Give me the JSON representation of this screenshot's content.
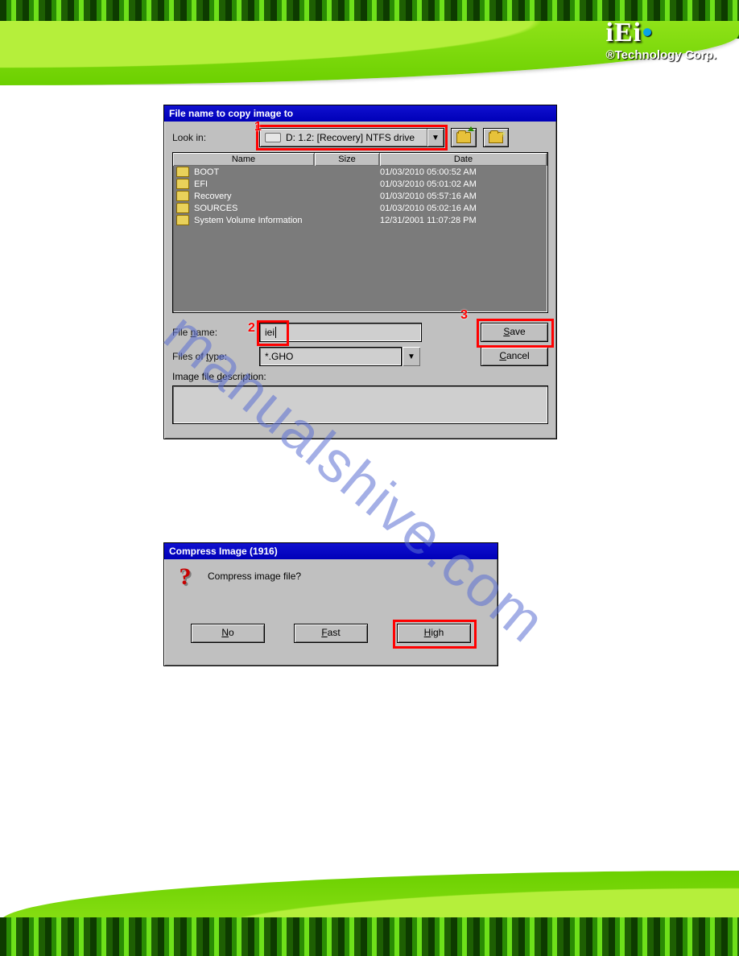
{
  "logo": {
    "brand": "iEi",
    "subtitle": "®Technology Corp."
  },
  "watermark": "manualshive.com",
  "dialog1": {
    "title": "File name to copy image to",
    "lookin_label": "Look in:",
    "lookin_value": "D: 1.2: [Recovery] NTFS drive",
    "columns": {
      "name": "Name",
      "size": "Size",
      "date": "Date"
    },
    "rows": [
      {
        "name": "BOOT",
        "date": "01/03/2010 05:00:52 AM"
      },
      {
        "name": "EFI",
        "date": "01/03/2010 05:01:02 AM"
      },
      {
        "name": "Recovery",
        "date": "01/03/2010 05:57:16 AM"
      },
      {
        "name": "SOURCES",
        "date": "01/03/2010 05:02:16 AM"
      },
      {
        "name": "System Volume Information",
        "date": "12/31/2001 11:07:28 PM"
      }
    ],
    "filename_label": "File name:",
    "filename_value": "iei",
    "filetype_label": "Files of type:",
    "filetype_value": "*.GHO",
    "desc_label": "Image file description:",
    "save": "Save",
    "cancel": "Cancel",
    "ann": {
      "n1": "1",
      "n2": "2",
      "n3": "3"
    }
  },
  "dialog2": {
    "title": "Compress Image (1916)",
    "message": "Compress image file?",
    "no": "No",
    "fast": "Fast",
    "high": "High"
  }
}
